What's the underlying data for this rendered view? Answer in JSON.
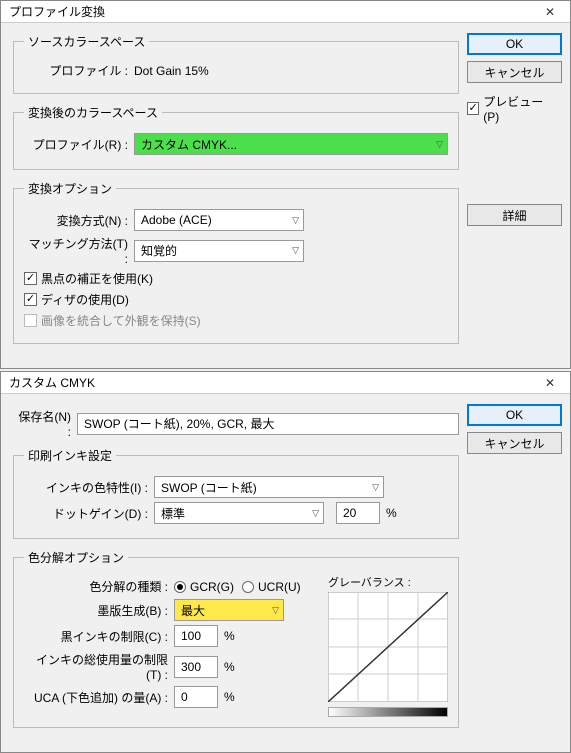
{
  "dialog1": {
    "title": "プロファイル変換",
    "source": {
      "legend": "ソースカラースペース",
      "profile_label": "プロファイル :",
      "profile_value": "Dot Gain 15%"
    },
    "dest": {
      "legend": "変換後のカラースペース",
      "profile_label": "プロファイル(R) :",
      "profile_value": "カスタム CMYK..."
    },
    "options": {
      "legend": "変換オプション",
      "engine_label": "変換方式(N) :",
      "engine_value": "Adobe (ACE)",
      "intent_label": "マッチング方法(T) :",
      "intent_value": "知覚的",
      "bpc": "黒点の補正を使用(K)",
      "dither": "ディザの使用(D)",
      "flatten": "画像を統合して外観を保持(S)"
    },
    "ok": "OK",
    "cancel": "キャンセル",
    "preview": "プレビュー(P)",
    "detail": "詳細"
  },
  "dialog2": {
    "title": "カスタム CMYK",
    "name_label": "保存名(N) :",
    "name_value": "SWOP (コート紙), 20%, GCR, 最大",
    "ink": {
      "legend": "印刷インキ設定",
      "colors_label": "インキの色特性(I) :",
      "colors_value": "SWOP (コート紙)",
      "dotgain_label": "ドットゲイン(D) :",
      "dotgain_value": "標準",
      "dotgain_pct": "20",
      "pct": "%"
    },
    "sep": {
      "legend": "色分解オプション",
      "type_label": "色分解の種類 :",
      "gcr": "GCR(G)",
      "ucr": "UCR(U)",
      "gray_balance": "グレーバランス :",
      "black_gen_label": "墨版生成(B) :",
      "black_gen_value": "最大",
      "black_limit_label": "黒インキの制限(C) :",
      "black_limit_value": "100",
      "total_limit_label": "インキの総使用量の制限(T) :",
      "total_limit_value": "300",
      "uca_label": "UCA (下色追加) の量(A) :",
      "uca_value": "0",
      "pct": "%"
    },
    "ok": "OK",
    "cancel": "キャンセル"
  }
}
